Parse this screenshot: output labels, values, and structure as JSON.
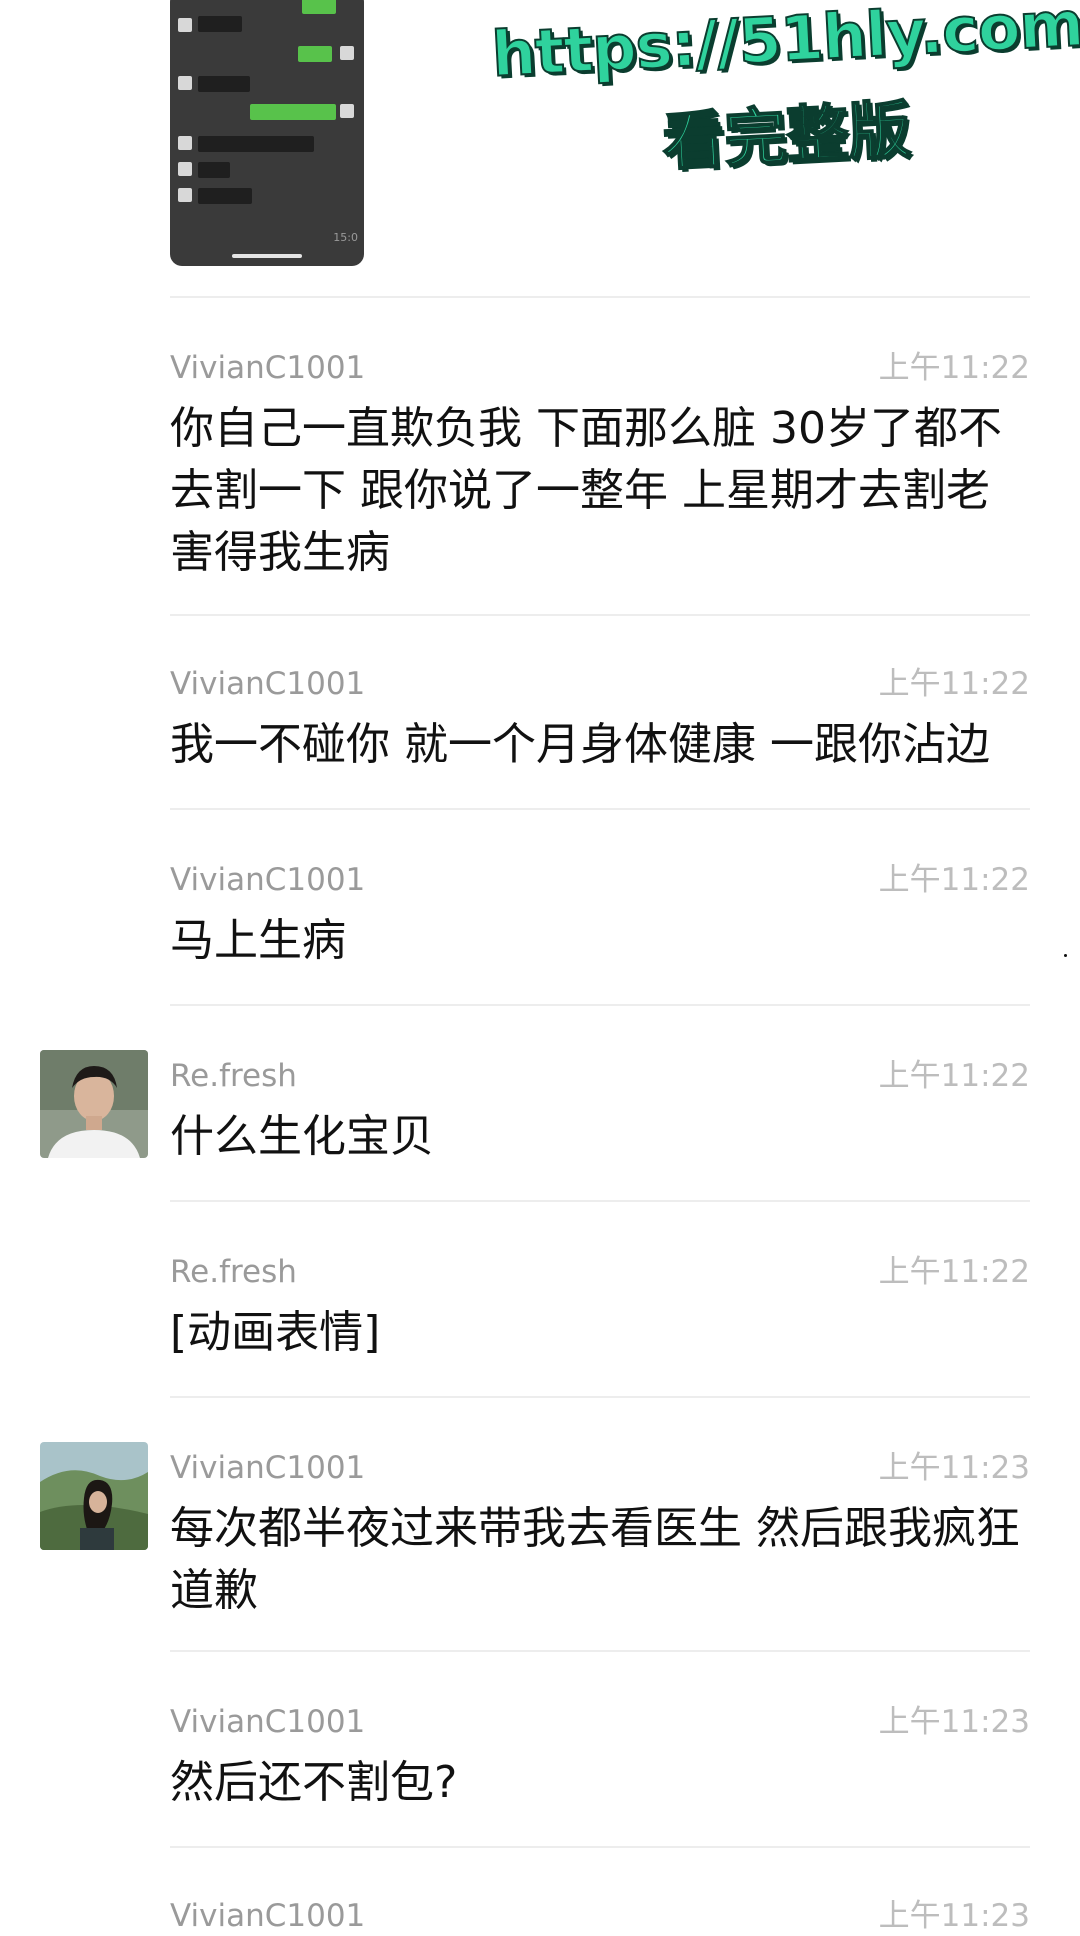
{
  "watermark": {
    "url": "https://51hly.com",
    "subtitle": "看完整版"
  },
  "thumbnail": {
    "time": "15:0"
  },
  "messages": [
    {
      "sender": "VivianC1001",
      "time": "上午11:22",
      "text": "你自己一直欺负我 下面那么脏 30岁了都不去割一下 跟你说了一整年 上星期才去割老害得我生病"
    },
    {
      "sender": "VivianC1001",
      "time": "上午11:22",
      "text": "我一不碰你 就一个月身体健康 一跟你沾边"
    },
    {
      "sender": "VivianC1001",
      "time": "上午11:22",
      "text": "马上生病"
    },
    {
      "sender": "Re.fresh",
      "time": "上午11:22",
      "text": "什么生化宝贝"
    },
    {
      "sender": "Re.fresh",
      "time": "上午11:22",
      "text": "[动画表情]"
    },
    {
      "sender": "VivianC1001",
      "time": "上午11:23",
      "text": "每次都半夜过来带我去看医生 然后跟我疯狂道歉"
    },
    {
      "sender": "VivianC1001",
      "time": "上午11:23",
      "text": "然后还不割包?"
    },
    {
      "sender": "VivianC1001",
      "time": "上午11:23",
      "text": ""
    }
  ]
}
